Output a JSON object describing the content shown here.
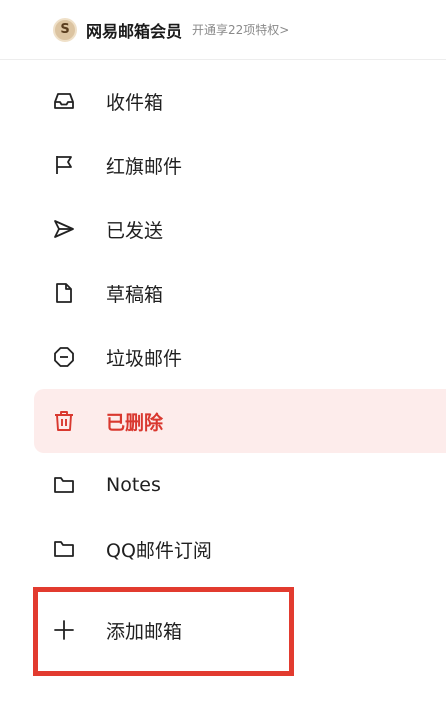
{
  "header": {
    "badge_glyph": "S",
    "title": "网易邮箱会员",
    "link": "开通享22项特权>"
  },
  "nav": {
    "items": [
      {
        "label": "收件箱",
        "icon": "inbox-icon"
      },
      {
        "label": "红旗邮件",
        "icon": "flag-icon"
      },
      {
        "label": "已发送",
        "icon": "send-icon"
      },
      {
        "label": "草稿箱",
        "icon": "draft-icon"
      },
      {
        "label": "垃圾邮件",
        "icon": "spam-icon"
      },
      {
        "label": "已删除",
        "icon": "trash-icon",
        "active": true
      },
      {
        "label": "Notes",
        "icon": "folder-icon"
      },
      {
        "label": "QQ邮件订阅",
        "icon": "folder-icon"
      }
    ]
  },
  "add_mailbox": {
    "label": "添加邮箱",
    "icon": "plus-icon"
  },
  "colors": {
    "accent": "#d9382f",
    "active_bg": "#fdeceb",
    "highlight_box": "#e23b2f"
  }
}
